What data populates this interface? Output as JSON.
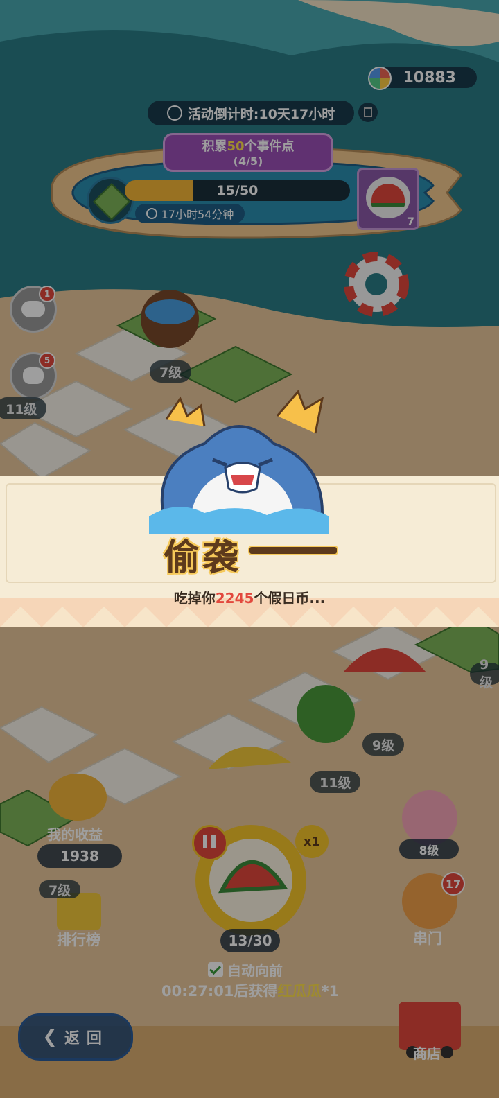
{
  "currency": {
    "icon": "rainbow-coin-icon",
    "value": "10883"
  },
  "countdown": {
    "label": "活动倒计时:10天17小时"
  },
  "event": {
    "title": "积累50个事件点",
    "title_prefix": "积累",
    "title_num": "50",
    "title_suffix": "个事件点",
    "sub": "(4/5)",
    "progress_text": "15/50",
    "progress": 0.3,
    "timer": "17小时54分钟",
    "reward_count": "7"
  },
  "side_badges": {
    "chat": "1",
    "rabbit": "5"
  },
  "tile_levels": [
    "7级",
    "11级",
    "9级",
    "11级",
    "9级",
    "7级"
  ],
  "popup": {
    "title": "偷袭",
    "dash": "——",
    "message_prefix": "吃掉你",
    "message_amount": "2245",
    "message_suffix": "个假日币..."
  },
  "earnings": {
    "label": "我的收益",
    "value": "1938"
  },
  "leaderboard": {
    "label": "排行榜"
  },
  "dice": {
    "multiplier": "x1",
    "count": "13/30"
  },
  "auto": {
    "label": "自动向前",
    "next_prefix": "00:27:01后获得",
    "next_item": "红瓜瓜",
    "next_suffix": "*1"
  },
  "right_items": {
    "level": "8级",
    "door_label": "串门",
    "door_badge": "17",
    "shop_label": "商店"
  },
  "back": {
    "label": "返回"
  },
  "colors": {
    "accent": "#e2483d",
    "banner": "#f6ecd6",
    "title": "#5d3a1c",
    "gold": "#f6c95a"
  }
}
